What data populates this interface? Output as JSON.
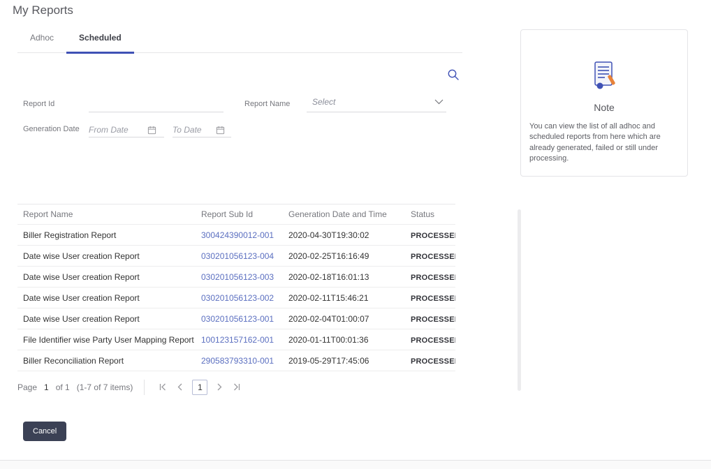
{
  "page": {
    "title": "My Reports"
  },
  "tabs": {
    "adhoc": "Adhoc",
    "scheduled": "Scheduled"
  },
  "filters": {
    "report_id_label": "Report Id",
    "report_name_label": "Report Name",
    "report_name_value": "Select",
    "generation_date_label": "Generation Date",
    "from_date_placeholder": "From Date",
    "to_date_placeholder": "To Date"
  },
  "table": {
    "headers": {
      "name": "Report Name",
      "sub_id": "Report Sub Id",
      "datetime": "Generation Date and Time",
      "status": "Status"
    },
    "rows": [
      {
        "name": "Biller Registration Report",
        "sub_id": "300424390012-001",
        "datetime": "2020-04-30T19:30:02",
        "status": "PROCESSED"
      },
      {
        "name": "Date wise User creation Report",
        "sub_id": "030201056123-004",
        "datetime": "2020-02-25T16:16:49",
        "status": "PROCESSED"
      },
      {
        "name": "Date wise User creation Report",
        "sub_id": "030201056123-003",
        "datetime": "2020-02-18T16:01:13",
        "status": "PROCESSED"
      },
      {
        "name": "Date wise User creation Report",
        "sub_id": "030201056123-002",
        "datetime": "2020-02-11T15:46:21",
        "status": "PROCESSED"
      },
      {
        "name": "Date wise User creation Report",
        "sub_id": "030201056123-001",
        "datetime": "2020-02-04T01:00:07",
        "status": "PROCESSED"
      },
      {
        "name": "File Identifier wise Party User Mapping Report",
        "sub_id": "100123157162-001",
        "datetime": "2020-01-11T00:01:36",
        "status": "PROCESSED"
      },
      {
        "name": "Biller Reconciliation Report",
        "sub_id": "290583793310-001",
        "datetime": "2019-05-29T17:45:06",
        "status": "PROCESSED"
      }
    ]
  },
  "pagination": {
    "page_label": "Page",
    "current_page": "1",
    "of_text": "of 1",
    "items_text": "(1-7 of 7 items)"
  },
  "actions": {
    "cancel": "Cancel"
  },
  "note": {
    "title": "Note",
    "body": "You can view the list of all adhoc and scheduled reports from here which are already generated, failed or still under processing."
  },
  "colors": {
    "accent": "#3f51b5",
    "link": "#5b6fc0",
    "button": "#3b4155"
  }
}
